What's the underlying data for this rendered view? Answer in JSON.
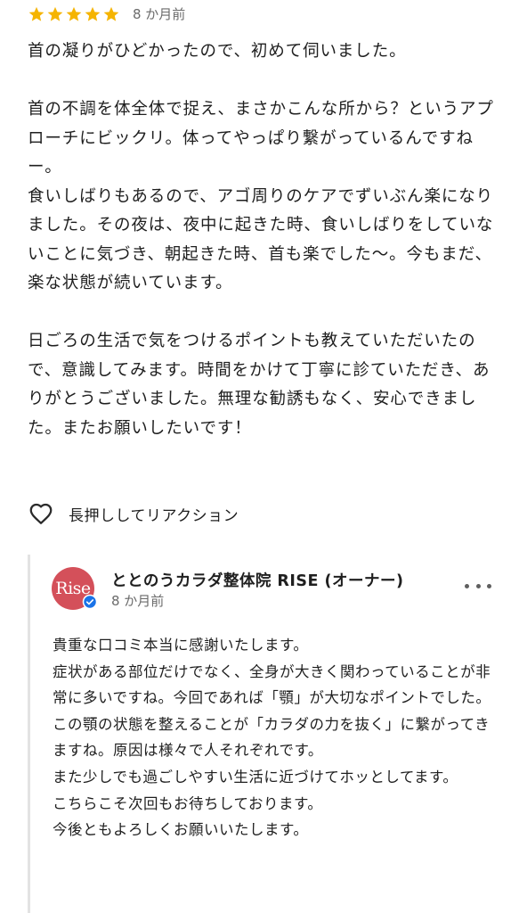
{
  "review": {
    "rating": 5,
    "rating_max": 5,
    "star_color": "#f5b400",
    "date": "8 か月前",
    "paragraphs": [
      [
        "首の凝りがひどかったので、初めて伺いました。"
      ],
      [
        "首の不調を体全体で捉え、まさかこんな所から？というアプローチにビックリ。体ってやっぱり繋がっているんですねー。",
        "食いしばりもあるので、アゴ周りのケアでずいぶん楽になりました。その夜は、夜中に起きた時、食いしばりをしていないことに気づき、朝起きた時、首も楽でした〜。今もまだ、楽な状態が続いています。"
      ],
      [
        "日ごろの生活で気をつけるポイントも教えていただいたので、意識してみます。時間をかけて丁寧に診ていただき、ありがとうございました。無理な勧誘もなく、安心できました。またお願いしたいです！"
      ]
    ]
  },
  "reaction": {
    "icon": "heart-outline-icon",
    "label": "長押ししてリアクション"
  },
  "owner_reply": {
    "avatar_text": "Rise",
    "avatar_color": "#d4505a",
    "badge_icon": "verified-check-icon",
    "badge_color": "#1a73e8",
    "name": "ととのうカラダ整体院 RISE (オーナー)",
    "date": "8 か月前",
    "more_icon": "more-horizontal-icon",
    "lines": [
      "貴重な口コミ本当に感謝いたします。",
      "症状がある部位だけでなく、全身が大きく関わっていることが非常に多いですね。今回であれば「顎」が大切なポイントでした。この顎の状態を整えることが「カラダの力を抜く」に繋がってきますね。原因は様々で人それぞれです。",
      "また少しでも過ごしやすい生活に近づけてホッとしてます。",
      "こちらこそ次回もお待ちしております。",
      "今後ともよろしくお願いいたします。"
    ]
  }
}
